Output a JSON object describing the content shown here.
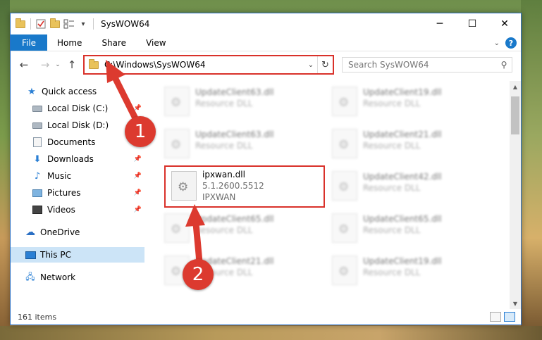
{
  "window": {
    "title": "SysWOW64"
  },
  "titlebar": {
    "minimize": "─",
    "maximize": "☐",
    "close": "✕",
    "qat_dropdown": "▾"
  },
  "ribbon": {
    "tabs": [
      "File",
      "Home",
      "Share",
      "View"
    ],
    "collapse": "⌄",
    "help": "?"
  },
  "navigation": {
    "back": "←",
    "forward": "→",
    "recent": "⌄",
    "up": "↑",
    "address_path": "C:\\Windows\\SysWOW64",
    "address_dropdown": "⌄",
    "refresh": "↻",
    "search_placeholder": "Search SysWOW64",
    "search_icon": "⚲"
  },
  "sidebar": {
    "items": [
      {
        "label": "Quick access",
        "icon": "star-icon"
      },
      {
        "label": "Local Disk (C:)",
        "icon": "disk-icon",
        "pinned": true
      },
      {
        "label": "Local Disk (D:)",
        "icon": "disk-icon"
      },
      {
        "label": "Documents",
        "icon": "documents-icon"
      },
      {
        "label": "Downloads",
        "icon": "download-icon",
        "pinned": true
      },
      {
        "label": "Music",
        "icon": "music-icon",
        "pinned": true
      },
      {
        "label": "Pictures",
        "icon": "pictures-icon",
        "pinned": true
      },
      {
        "label": "Videos",
        "icon": "videos-icon",
        "pinned": true
      },
      {
        "label": "OneDrive",
        "icon": "cloud-icon"
      },
      {
        "label": "This PC",
        "icon": "computer-icon",
        "selected": true
      },
      {
        "label": "Network",
        "icon": "network-icon"
      }
    ],
    "pin_glyph": "📌"
  },
  "files": [
    {
      "name": "UpdateClient63.dll",
      "sub1": "Resource DLL",
      "sub2": "",
      "blurred": true
    },
    {
      "name": "UpdateClient19.dll",
      "sub1": "Resource DLL",
      "sub2": "",
      "blurred": true
    },
    {
      "name": "UpdateClient63.dll",
      "sub1": "Resource DLL",
      "sub2": "",
      "blurred": true
    },
    {
      "name": "UpdateClient21.dll",
      "sub1": "Resource DLL",
      "sub2": "",
      "blurred": true
    },
    {
      "name": "ipxwan.dll",
      "sub1": "5.1.2600.5512",
      "sub2": "IPXWAN",
      "blurred": false,
      "highlighted": true
    },
    {
      "name": "UpdateClient42.dll",
      "sub1": "Resource DLL",
      "sub2": "",
      "blurred": true
    },
    {
      "name": "UpdateClient65.dll",
      "sub1": "Resource DLL",
      "sub2": "",
      "blurred": true
    },
    {
      "name": "UpdateClient65.dll",
      "sub1": "Resource DLL",
      "sub2": "",
      "blurred": true
    },
    {
      "name": "UpdateClient21.dll",
      "sub1": "Resource DLL",
      "sub2": "",
      "blurred": true
    },
    {
      "name": "UpdateClient19.dll",
      "sub1": "Resource DLL",
      "sub2": "",
      "blurred": true
    }
  ],
  "scrollbar": {
    "up": "▲",
    "down": "▼"
  },
  "status": {
    "item_count": "161 items"
  },
  "annotations": [
    {
      "label": "1"
    },
    {
      "label": "2"
    }
  ],
  "colors": {
    "accent": "#1979ca",
    "highlight_red": "#d9312a",
    "selected_nav": "#cce4f7",
    "callout_red": "#dc3a2f"
  }
}
